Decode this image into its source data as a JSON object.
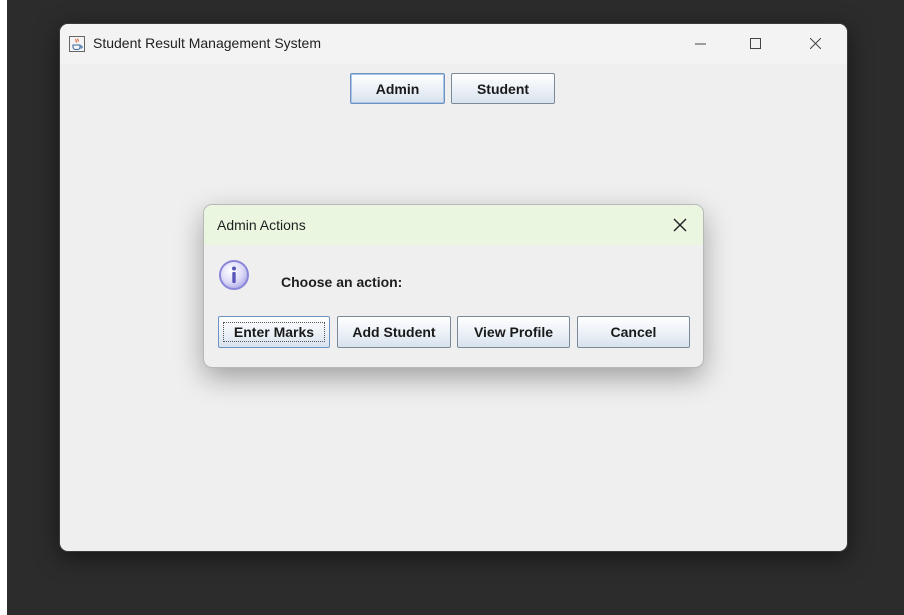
{
  "main_window": {
    "title": "Student Result Management System",
    "icon": "java-cup-icon",
    "controls": {
      "minimize_icon": "minimize-icon",
      "maximize_icon": "maximize-icon",
      "close_icon": "close-icon"
    },
    "buttons": {
      "admin_label": "Admin",
      "student_label": "Student"
    }
  },
  "dialog": {
    "title": "Admin Actions",
    "close_icon": "close-icon",
    "message_icon": "info-icon",
    "message": "Choose an action:",
    "buttons": {
      "enter_marks_label": "Enter Marks",
      "add_student_label": "Add Student",
      "view_profile_label": "View Profile",
      "cancel_label": "Cancel"
    },
    "focused_button": "Enter Marks"
  },
  "colors": {
    "desktop": "#2c2c2c",
    "window_bg": "#efefef",
    "dialog_titlebar": "#eaf6e0",
    "button_border": "#7a8a99",
    "focus_border": "#6d93c2",
    "info_icon": "#8a86d8"
  }
}
